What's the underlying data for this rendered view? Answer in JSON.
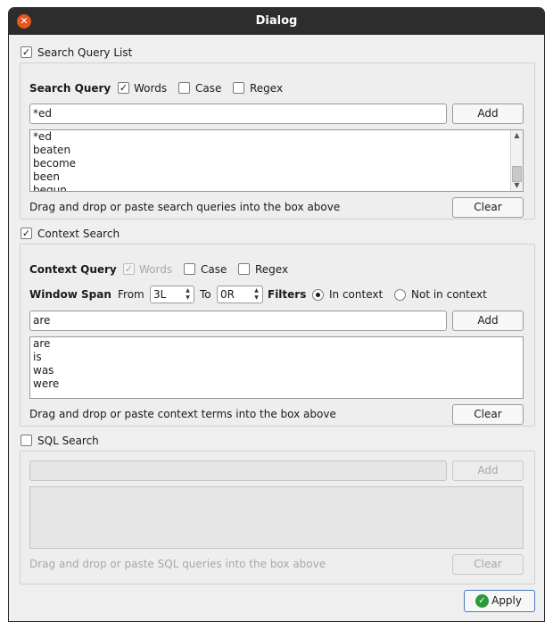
{
  "window": {
    "title": "Dialog"
  },
  "search_query_list": {
    "label": "Search Query List",
    "checked": true,
    "query_label": "Search Query",
    "words_label": "Words",
    "case_label": "Case",
    "regex_label": "Regex",
    "input_value": "*ed",
    "add_label": "Add",
    "items": [
      "*ed",
      "beaten",
      "become",
      "been",
      "begun"
    ],
    "hint": "Drag and drop or paste search queries into the box above",
    "clear_label": "Clear"
  },
  "context_search": {
    "label": "Context Search",
    "checked": true,
    "query_label": "Context Query",
    "words_label": "Words",
    "case_label": "Case",
    "regex_label": "Regex",
    "window_span_label": "Window Span",
    "from_label": "From",
    "from_value": "3L",
    "to_label": "To",
    "to_value": "0R",
    "filters_label": "Filters",
    "in_context_label": "In context",
    "not_in_context_label": "Not in context",
    "input_value": "are",
    "add_label": "Add",
    "items": [
      "are",
      "is",
      "was",
      "were"
    ],
    "hint": "Drag and drop or paste context terms into the box above",
    "clear_label": "Clear"
  },
  "sql_search": {
    "label": "SQL Search",
    "checked": false,
    "input_value": "",
    "add_label": "Add",
    "hint": "Drag and drop or paste SQL queries into the box above",
    "clear_label": "Clear"
  },
  "footer": {
    "apply_label": "Apply"
  },
  "icons": {
    "close": "close-icon",
    "apply": "check-circle-icon"
  },
  "colors": {
    "titlebar": "#2d2d2d",
    "close": "#e9541f",
    "apply_icon": "#2e9a3e"
  }
}
